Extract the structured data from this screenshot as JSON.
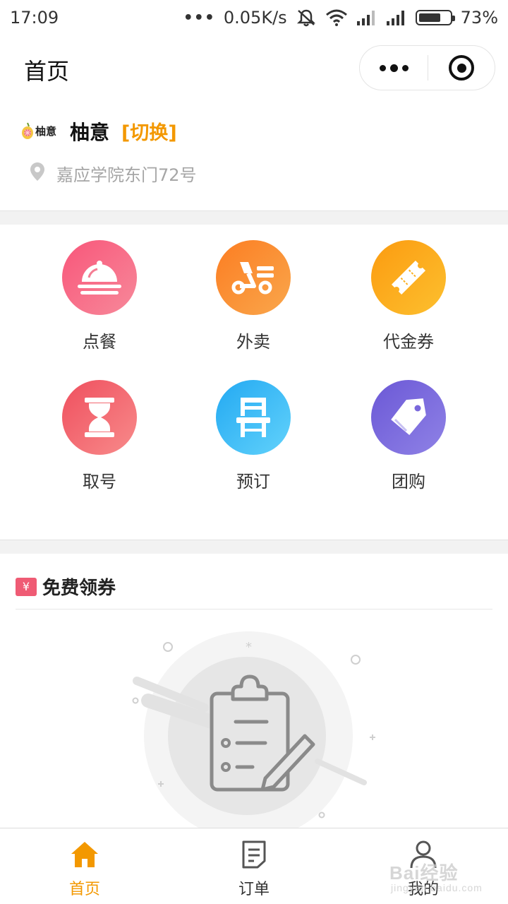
{
  "status_bar": {
    "time": "17:09",
    "network_speed": "0.05K/s",
    "battery_percent": "73%",
    "battery_level": 0.73,
    "icons": [
      "more-dots-icon",
      "mute-vibrate-icon",
      "wifi-icon",
      "signal-icon",
      "signal-icon",
      "battery-icon"
    ]
  },
  "header": {
    "title": "首页"
  },
  "store": {
    "logo_text": "柚意",
    "name": "柚意",
    "switch_label": "[切换]",
    "address": "嘉应学院东门72号",
    "accent_color": "#f39800"
  },
  "menu": {
    "items": [
      {
        "label": "点餐",
        "icon": "food-cloche-icon",
        "color_from": "#f8567a",
        "color_to": "#f7899a"
      },
      {
        "label": "外卖",
        "icon": "delivery-scooter-icon",
        "color_from": "#fc7d22",
        "color_to": "#f9a74c"
      },
      {
        "label": "代金券",
        "icon": "voucher-ticket-icon",
        "color_from": "#fb9b10",
        "color_to": "#fdc02f"
      },
      {
        "label": "取号",
        "icon": "hourglass-icon",
        "color_from": "#ef4f5e",
        "color_to": "#f88b8b"
      },
      {
        "label": "预订",
        "icon": "reserve-chair-icon",
        "color_from": "#23a9f2",
        "color_to": "#62d2fb"
      },
      {
        "label": "团购",
        "icon": "group-buy-tag-icon",
        "color_from": "#6b58d6",
        "color_to": "#8f82e6"
      }
    ]
  },
  "coupons": {
    "title": "免费领券",
    "icon": "coupon-yen-icon",
    "yen_symbol": "¥",
    "empty_icon": "empty-clipboard-icon"
  },
  "tabbar": {
    "tabs": [
      {
        "label": "首页",
        "icon": "home-icon",
        "active": true
      },
      {
        "label": "订单",
        "icon": "order-document-icon",
        "active": false
      },
      {
        "label": "我的",
        "icon": "user-profile-icon",
        "active": false
      }
    ]
  },
  "watermark": {
    "text": "Bai经验",
    "sub": "jingyan.baidu.com"
  }
}
